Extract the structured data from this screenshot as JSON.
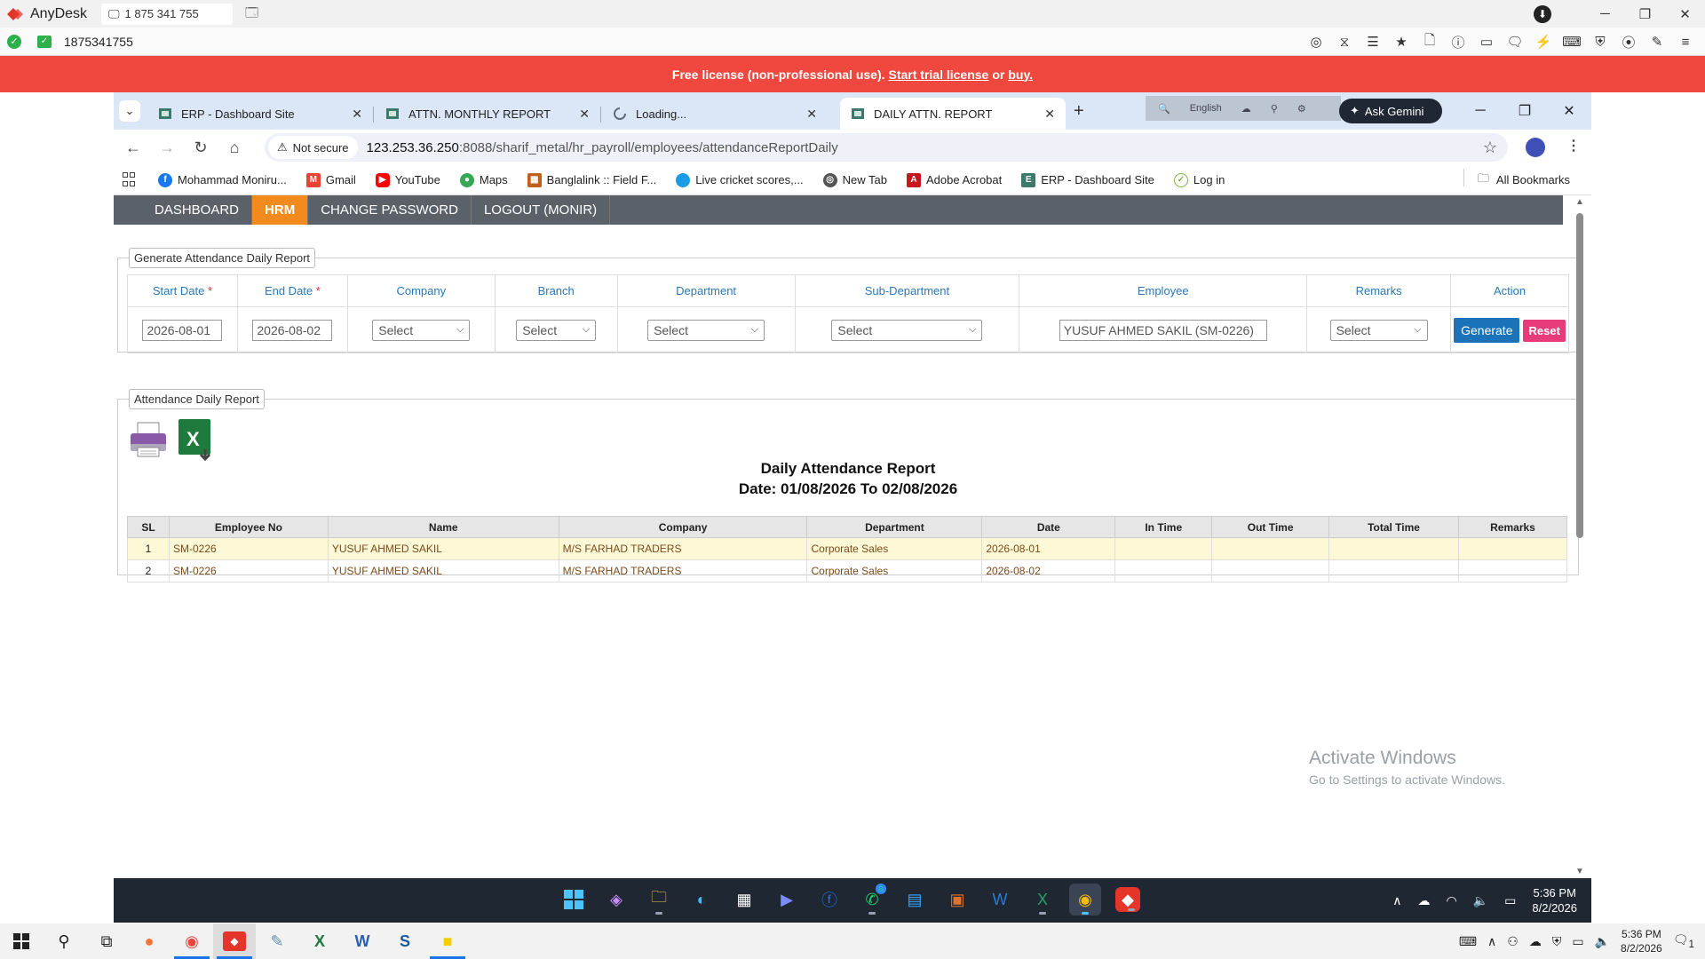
{
  "anydesk": {
    "app_name": "AnyDesk",
    "tab_label": "1 875 341 755",
    "address_id": "1875341755",
    "license_text": "Free license (non-professional use).",
    "license_link_trial": "Start trial license",
    "license_or": "or",
    "license_link_buy": "buy."
  },
  "browser": {
    "tabs": [
      {
        "title": "ERP - Dashboard Site",
        "active": false
      },
      {
        "title": "ATTN. MONTHLY REPORT",
        "active": false
      },
      {
        "title": "Loading...",
        "active": false
      },
      {
        "title": "DAILY ATTN. REPORT",
        "active": true
      }
    ],
    "ext_language": "English",
    "gemini_label": "Ask Gemini",
    "not_secure": "Not secure",
    "url_host": "123.253.36.250",
    "url_path": ":8088/sharif_metal/hr_payroll/employees/attendanceReportDaily",
    "bookmarks": [
      {
        "label": "Mohammad Moniru...",
        "icon": "facebook-icon",
        "color": "#1877f2"
      },
      {
        "label": "Gmail",
        "icon": "gmail-icon",
        "color": "#ea4335"
      },
      {
        "label": "YouTube",
        "icon": "youtube-icon",
        "color": "#ff0000"
      },
      {
        "label": "Maps",
        "icon": "maps-icon",
        "color": "#34a853"
      },
      {
        "label": "Banglalink :: Field F...",
        "icon": "banglalink-icon",
        "color": "#c0601a"
      },
      {
        "label": "Live cricket scores,...",
        "icon": "cricket-icon",
        "color": "#1a9be6"
      },
      {
        "label": "New Tab",
        "icon": "chrome-icon",
        "color": "#555555"
      },
      {
        "label": "Adobe Acrobat",
        "icon": "acrobat-icon",
        "color": "#c7161e"
      },
      {
        "label": "ERP - Dashboard Site",
        "icon": "erp-icon",
        "color": "#3d7a6e"
      },
      {
        "label": "Log in",
        "icon": "login-icon",
        "color": "#7cb342"
      }
    ],
    "all_bookmarks": "All Bookmarks"
  },
  "menu": {
    "items": [
      "DASHBOARD",
      "HRM",
      "CHANGE PASSWORD",
      "LOGOUT (MONIR)"
    ],
    "active_index": 1
  },
  "filter": {
    "legend": "Generate Attendance Daily Report",
    "headers": {
      "start_date": "Start Date",
      "end_date": "End Date",
      "company": "Company",
      "branch": "Branch",
      "department": "Department",
      "sub_department": "Sub-Department",
      "employee": "Employee",
      "remarks": "Remarks",
      "action": "Action"
    },
    "required_mark": "*",
    "start_date_value": "2026-08-01",
    "end_date_value": "2026-08-02",
    "company_value": "Select",
    "branch_value": "Select",
    "department_value": "Select",
    "sub_department_value": "Select",
    "employee_value": "YUSUF AHMED SAKIL (SM-0226)",
    "remarks_value": "Select",
    "generate_label": "Generate",
    "reset_label": "Reset"
  },
  "report": {
    "legend": "Attendance Daily Report",
    "title": "Daily Attendance Report",
    "date_range": "Date: 01/08/2026 To 02/08/2026",
    "columns": [
      "SL",
      "Employee No",
      "Name",
      "Company",
      "Department",
      "Date",
      "In Time",
      "Out Time",
      "Total Time",
      "Remarks"
    ],
    "rows": [
      [
        "1",
        "SM-0226",
        "YUSUF AHMED SAKIL",
        "M/S FARHAD TRADERS",
        "Corporate Sales",
        "2026-08-01",
        "",
        "",
        "",
        ""
      ],
      [
        "2",
        "SM-0226",
        "YUSUF AHMED SAKIL",
        "M/S FARHAD TRADERS",
        "Corporate Sales",
        "2026-08-02",
        "",
        "",
        "",
        ""
      ]
    ]
  },
  "watermark": {
    "line1": "Activate Windows",
    "line2": "Go to Settings to activate Windows."
  },
  "remote_taskbar": {
    "time": "5:36 PM",
    "date": "8/2/2026",
    "whatsapp_badge": "6"
  },
  "local_taskbar": {
    "time": "5:36 PM",
    "date": "8/2/2026",
    "notification_count": "1"
  }
}
